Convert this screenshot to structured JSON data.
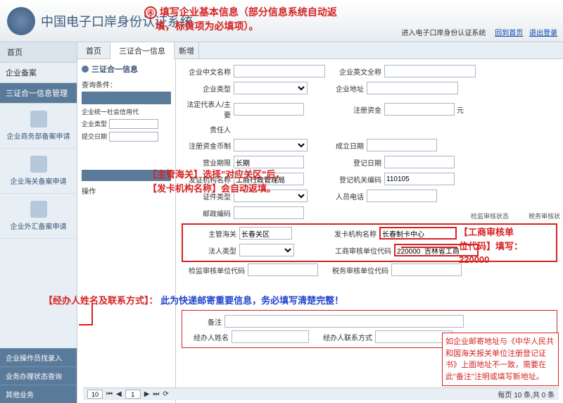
{
  "header": {
    "title": "中国电子口岸身份认证系统",
    "link_enter": "进入电子口岸身份认证系统",
    "link_home": "回到首页",
    "link_exit": "退出登录"
  },
  "annotations": {
    "top_num": "④",
    "top_text1": "填写企业基本信息（部分信息系统自动返",
    "top_text2": "填，标黄项为必填项）。",
    "mid_line1": "【主管海关】选择\"对应关区\"后，",
    "mid_line2": "【发卡机构名称】会自动返填。",
    "contact_label": "【经办人姓名及联系方式】：",
    "contact_note": "此为快递邮寄重要信息，务必填写清楚完整！",
    "right1_l1": "【工商审核单",
    "right1_l2": "位代码】填写：",
    "right1_l3": "220000",
    "right2": "如企业邮寄地址与《中华人民共和国海关报关单位注册登记证书》上面地址不一致，需要在此\"备注\"注明或填写新地址。"
  },
  "nav": {
    "home": "首页",
    "section1": "企业备案",
    "item_info": "三证合一信息管理",
    "item_biz": "企业商务部备案申请",
    "item_customs": "企业海关备案申请",
    "item_fx": "企业外汇备案申请",
    "bottom1": "企业操作员找录入",
    "bottom2": "业务办理状态查询",
    "bottom3": "其他业务"
  },
  "tabs": {
    "t1": "首页",
    "t2": "三证合一信息",
    "t3": "新增"
  },
  "left_panel": {
    "title": "三证合一信息",
    "query_label": "查询条件：",
    "f1": "企业统一社会信用代",
    "f2": "企业类型",
    "f3": "提交日期",
    "ops": "操作"
  },
  "right_small": {
    "a": "检监审核状态",
    "b": "税务审核状"
  },
  "form": {
    "cn_name": "企业中文名称",
    "en_name": "企业英文全称",
    "ent_type": "企业类型",
    "ent_addr": "企业地址",
    "legal_rep": "法定代表人/主要",
    "reg_capital": "注册资金",
    "resp": "责任人",
    "unit_yuan": "元",
    "reg_currency": "注册资金币制",
    "est_date": "成立日期",
    "biz_period": "营业期限",
    "biz_period_val": "长期",
    "reg_date": "登记日期",
    "issuer": "发证机构名称",
    "issuer_val": "工商行政管理局",
    "reg_no": "登记机关编码",
    "reg_no_val": "110105",
    "cert_type": "证件类型",
    "contact_tel": "人员电话",
    "postcode": "邮政编码",
    "customs": "主管海关",
    "customs_val": "长春关区",
    "card_org": "发卡机构名称",
    "card_org_val": "长春制卡中心",
    "legal_type": "法人类型",
    "biz_audit_code": "工商审核单位代码",
    "biz_audit_val": "220000  吉林省工商",
    "insp_code": "检监审核单位代码",
    "tax_code": "税务审核单位代码",
    "remark": "备注",
    "handler_name": "经办人姓名",
    "handler_contact": "经办人联系方式"
  },
  "pager": {
    "size": "10",
    "page": "1",
    "info": "每页 10 条,共 0 条"
  }
}
